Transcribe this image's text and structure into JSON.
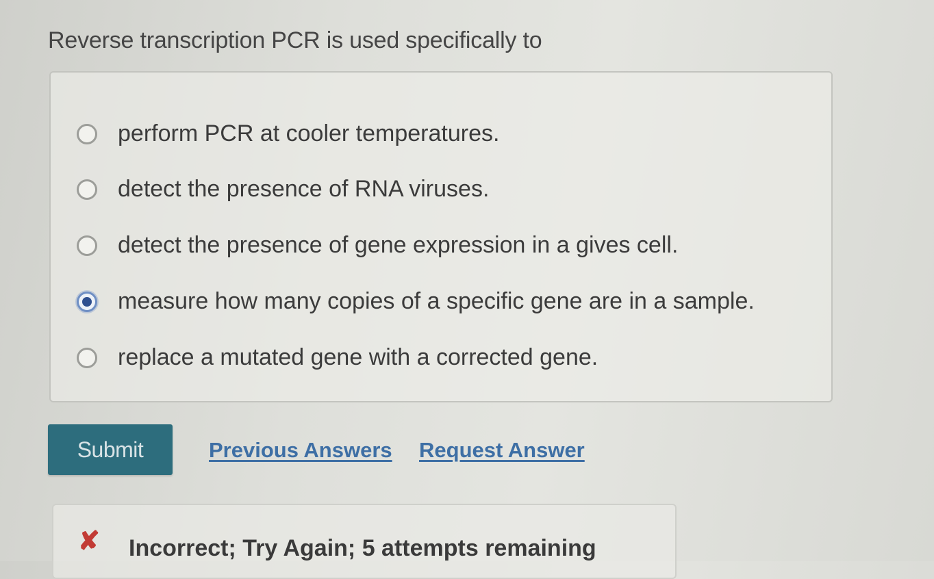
{
  "question": {
    "text": "Reverse transcription PCR is used specifically to"
  },
  "options": [
    {
      "label": "perform PCR at cooler temperatures.",
      "selected": false
    },
    {
      "label": "detect the presence of RNA viruses.",
      "selected": false
    },
    {
      "label": "detect the presence of gene expression in a gives cell.",
      "selected": false
    },
    {
      "label": "measure how many copies of a specific gene are in a sample.",
      "selected": true
    },
    {
      "label": "replace a mutated gene with a corrected gene.",
      "selected": false
    }
  ],
  "actions": {
    "submit_label": "Submit",
    "previous_answers_label": "Previous Answers",
    "request_answer_label": "Request Answer"
  },
  "feedback": {
    "icon": "x-icon",
    "icon_glyph": "✘",
    "text": "Incorrect; Try Again; 5 attempts remaining",
    "icon_color": "#c23b35"
  },
  "colors": {
    "submit_bg": "#2d6d7d",
    "link": "#3e6fa5",
    "radio_selected": "#2e4f8f"
  }
}
